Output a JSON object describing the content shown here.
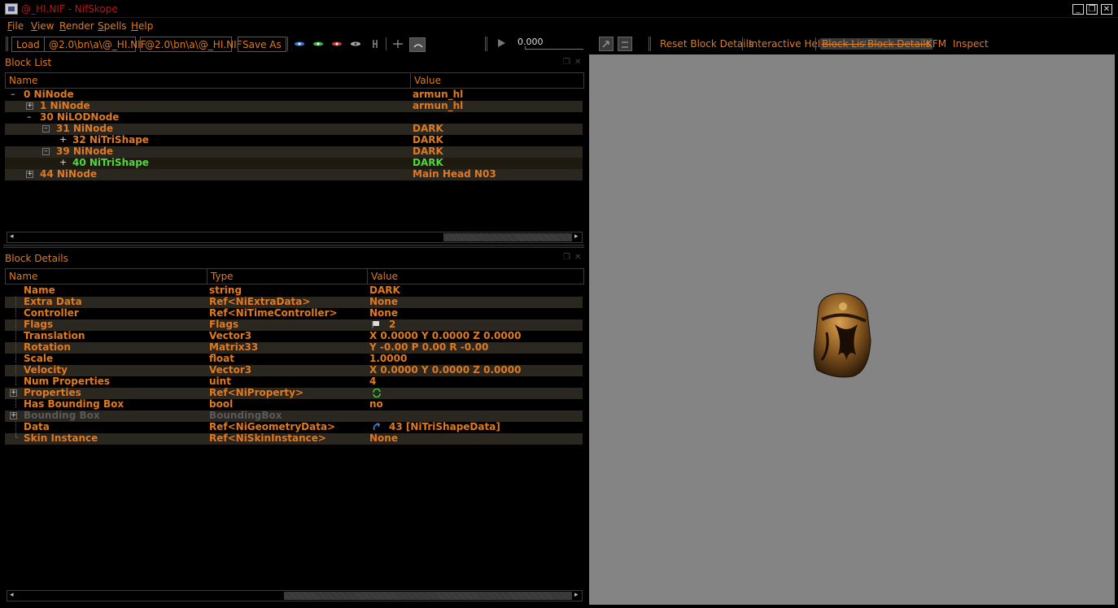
{
  "window": {
    "title": "@_HI.NIF - NifSkope",
    "min_icon": "minimize-icon",
    "max_icon": "restore-icon",
    "close_icon": "close-icon"
  },
  "menu": [
    "File",
    "View",
    "Render",
    "Spells",
    "Help"
  ],
  "toolbar": {
    "load_label": "Load",
    "load_path": "@2.0\\bn\\a\\@_HI.NIF",
    "save_path": "@2.0\\bn\\a\\@_HI.NIF",
    "save_as_label": "Save As",
    "time_value": "0.000",
    "reset_block_details": "Reset Block Details",
    "interactive_help": "Interactive Help",
    "block_list": "Block List",
    "block_details": "Block Details",
    "kfm": "KFM",
    "inspect": "Inspect"
  },
  "block_list": {
    "title": "Block List",
    "columns": [
      "Name",
      "Value"
    ],
    "rows": [
      {
        "name": "0 NiNode",
        "value": "armun_hl",
        "expander": "-"
      },
      {
        "name": "1 NiNode",
        "value": "armun_hl",
        "expander": "+"
      },
      {
        "name": "30 NiLODNode",
        "value": "",
        "expander": "-"
      },
      {
        "name": "31 NiNode",
        "value": "DARK",
        "expander": "-"
      },
      {
        "name": "32 NiTriShape",
        "value": "DARK",
        "expander": "+"
      },
      {
        "name": "39 NiNode",
        "value": "DARK",
        "expander": "-"
      },
      {
        "name": "40 NiTriShape",
        "value": "DARK",
        "expander": "+"
      },
      {
        "name": "44 NiNode",
        "value": "Main Head N03",
        "expander": "+"
      }
    ]
  },
  "block_details": {
    "title": "Block Details",
    "columns": [
      "Name",
      "Type",
      "Value"
    ],
    "rows": [
      {
        "name": "Name",
        "type": "string",
        "value": "DARK"
      },
      {
        "name": "Extra Data",
        "type": "Ref<NiExtraData>",
        "value": "None"
      },
      {
        "name": "Controller",
        "type": "Ref<NiTimeController>",
        "value": "None"
      },
      {
        "name": "Flags",
        "type": "Flags",
        "value": "2"
      },
      {
        "name": "Translation",
        "type": "Vector3",
        "value": "X 0.0000 Y 0.0000 Z 0.0000"
      },
      {
        "name": "Rotation",
        "type": "Matrix33",
        "value": "Y -0.00 P 0.00 R -0.00"
      },
      {
        "name": "Scale",
        "type": "float",
        "value": "1.0000"
      },
      {
        "name": "Velocity",
        "type": "Vector3",
        "value": "X 0.0000 Y 0.0000 Z 0.0000"
      },
      {
        "name": "Num Properties",
        "type": "uint",
        "value": "4"
      },
      {
        "name": "Properties",
        "type": "Ref<NiProperty>",
        "value": ""
      },
      {
        "name": "Has Bounding Box",
        "type": "bool",
        "value": "no"
      },
      {
        "name": "Bounding Box",
        "type": "BoundingBox",
        "value": ""
      },
      {
        "name": "Data",
        "type": "Ref<NiGeometryData>",
        "value": "43 [NiTriShapeData]"
      },
      {
        "name": "Skin Instance",
        "type": "Ref<NiSkinInstance>",
        "value": "None"
      }
    ]
  }
}
